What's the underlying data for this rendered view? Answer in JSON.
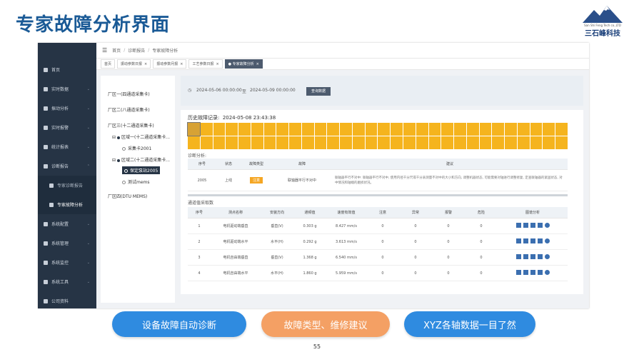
{
  "slide_title": "专家故障分析界面",
  "logo": {
    "en": "San Shi Feng Tech co.,LTD",
    "cn": "三石峰科技"
  },
  "sidebar": {
    "items": [
      {
        "label": "首页"
      },
      {
        "label": "实时数据"
      },
      {
        "label": "振动分析"
      },
      {
        "label": "实时报警"
      },
      {
        "label": "统计报表"
      },
      {
        "label": "诊断报告"
      },
      {
        "label": "专家诊断报告",
        "sub": true
      },
      {
        "label": "专家故障分析",
        "sub": true
      },
      {
        "label": "系统配置"
      },
      {
        "label": "系统管理"
      },
      {
        "label": "系统监控"
      },
      {
        "label": "系统工具"
      },
      {
        "label": "公司资料"
      }
    ]
  },
  "breadcrumb": {
    "home": "首页",
    "level1": "诊断报告",
    "level2": "专家故障分析"
  },
  "tabs": [
    {
      "label": "首页"
    },
    {
      "label": "振动参数日报"
    },
    {
      "label": "振动参数月报"
    },
    {
      "label": "工艺参数日报"
    },
    {
      "label": "专家故障分析"
    }
  ],
  "tree": {
    "area1": "厂区一(四通道采集卡)",
    "area2": "厂区二(八通道采集卡)",
    "area3": "厂区三(十二通道采集卡)",
    "region1": "区域一(十二通道采集卡...",
    "collector": "采集卡2001",
    "region2": "区域二(十二通道采集卡...",
    "protect": "保定泵站2005",
    "mems": "测试mems",
    "area4": "厂区四(DTU MEMS)"
  },
  "filter": {
    "start": "2024-05-06 00:00:00",
    "to": "至",
    "end": "2024-05-09 00:00:00",
    "query_button": "查询数据"
  },
  "history": {
    "label": "历史故障记录:",
    "time": "2024-05-08 23:43:38",
    "cells": 60
  },
  "diagnosis": {
    "label": "诊断分析:",
    "headers": [
      "序号",
      "状态",
      "故障类型",
      "故障",
      "建议"
    ],
    "row": {
      "id": "2005",
      "status": "上线",
      "type": "注意",
      "fault": "联轴器平行不对中",
      "advice": "联轴器平行不对中: 联轴器平行不对中, 使用内径千分尺或千分表测量不对中的大小和方向, 调整机器状态, 可能需要对轴进行调整修复, 定查联轴器的紧固状态, 对中情况和轴端的磨损状况。"
    }
  },
  "channels": {
    "label": "通道值采取数",
    "headers": [
      "序号",
      "测点名称",
      "安装方向",
      "通频值",
      "速度有效值",
      "注意",
      "异常",
      "报警",
      "危险",
      "图谱分析"
    ],
    "rows": [
      [
        "1",
        "电机驱动端垂直",
        "垂直(V)",
        "0.303 g",
        "8.427 mm/s",
        "0",
        "0",
        "0",
        "0"
      ],
      [
        "2",
        "电机驱动端水平",
        "水平(H)",
        "0.292 g",
        "3.613 mm/s",
        "0",
        "0",
        "0",
        "0"
      ],
      [
        "3",
        "电机自由端垂直",
        "垂直(V)",
        "1.368 g",
        "6.540 mm/s",
        "0",
        "0",
        "0",
        "0"
      ],
      [
        "4",
        "电机自由端水平",
        "水平(H)",
        "1.860 g",
        "5.959 mm/s",
        "0",
        "0",
        "0",
        "0"
      ]
    ]
  },
  "features": [
    {
      "label": "设备故障自动诊断",
      "color": "#2f8be0"
    },
    {
      "label": "故障类型、维修建议",
      "color": "#f4a064"
    },
    {
      "label": "XYZ各轴数据一目了然",
      "color": "#2f8be0"
    }
  ],
  "page_number": "55"
}
